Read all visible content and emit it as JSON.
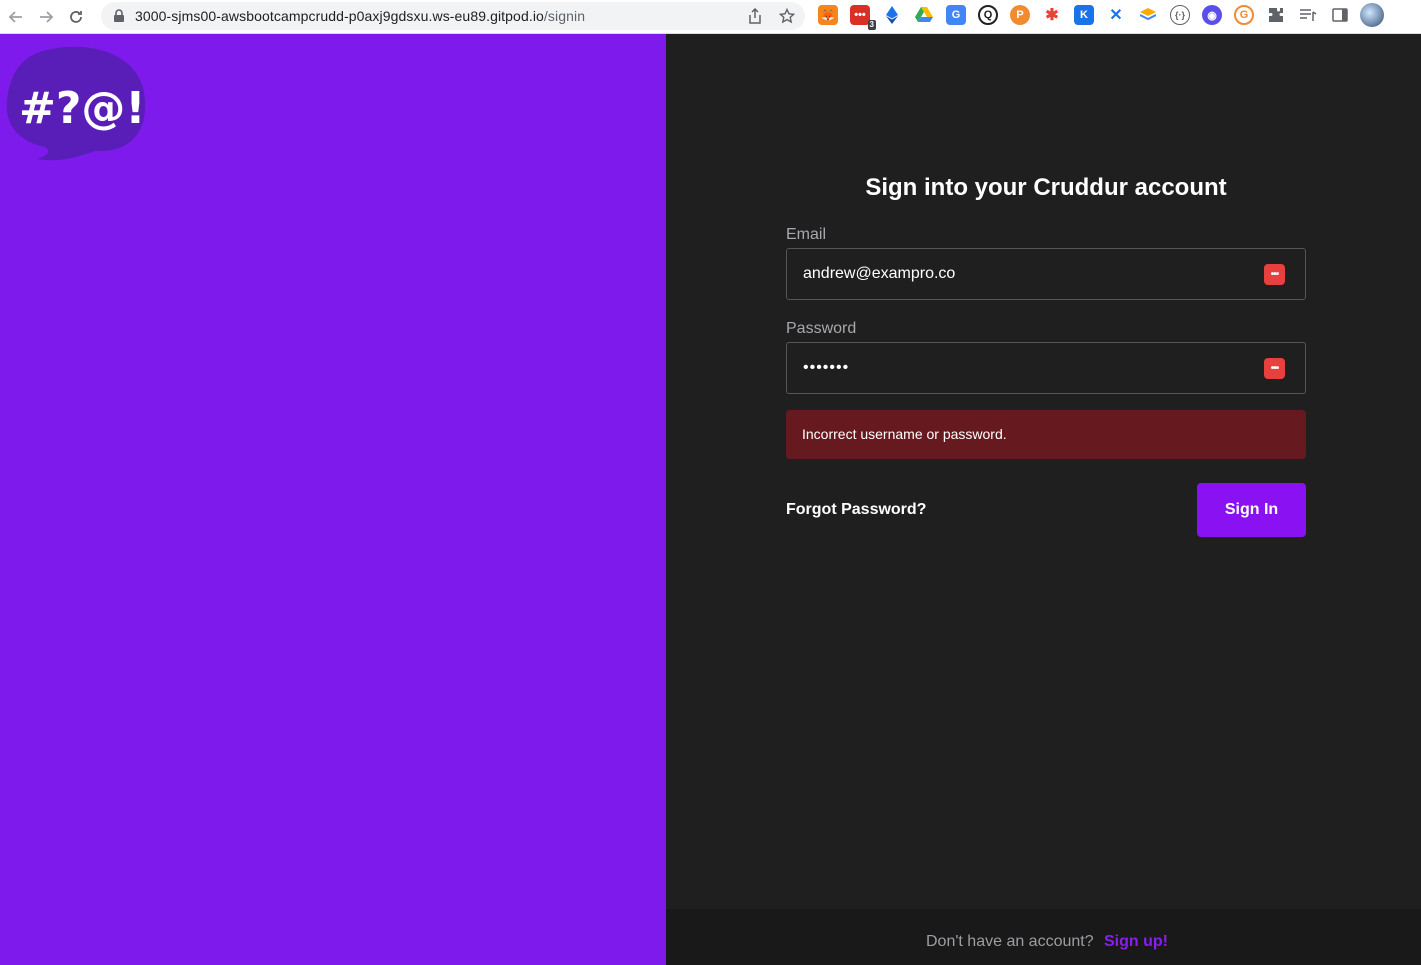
{
  "browser": {
    "url_host": "3000-sjms00-awsbootcampcrudd-p0axj9gdsxu.ws-eu89.gitpod.io",
    "url_path": "/signin",
    "extension_badge": "3",
    "icons": [
      "back-arrow-icon",
      "forward-arrow-icon",
      "reload-icon",
      "lock-icon",
      "share-icon",
      "bookmark-star-icon",
      "extensions-puzzle-icon",
      "reading-list-icon",
      "side-panel-icon",
      "profile-avatar"
    ]
  },
  "logo": {
    "symbol_text": "#?@!"
  },
  "signin": {
    "title": "Sign into your Cruddur account",
    "email_label": "Email",
    "email_value": "andrew@exampro.co",
    "password_label": "Password",
    "password_value": "•••••••",
    "error_message": "Incorrect username or password.",
    "forgot_label": "Forgot Password?",
    "submit_label": "Sign In"
  },
  "footer": {
    "prompt": "Don't have an account?",
    "signup_label": "Sign up!"
  },
  "colors": {
    "brand_purple": "#7f1aed",
    "button_purple": "#8a12f2",
    "dark_bg": "#1f1f20",
    "error_bg": "#661a1f",
    "password_manager_red": "#e8403e"
  }
}
